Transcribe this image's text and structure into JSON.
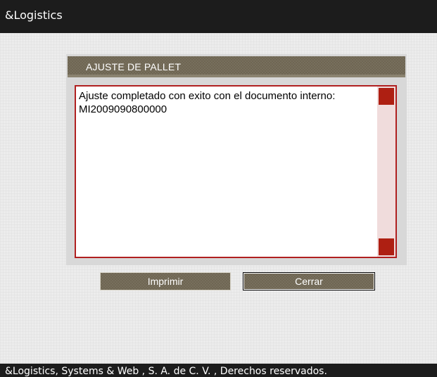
{
  "app": {
    "title": "&Logistics"
  },
  "dialog": {
    "title": "AJUSTE DE PALLET",
    "message": "Ajuste completado con exito con el documento interno: MI2009090800000"
  },
  "buttons": {
    "print_label": "Imprimir",
    "close_label": "Cerrar"
  },
  "footer": {
    "text": "&Logistics, Systems & Web , S. A. de C. V. , Derechos reservados."
  },
  "colors": {
    "titlebar": "#1c1c1c",
    "header_bg": "#6f6653",
    "border_accent": "#b02020",
    "scroll_button": "#ae1f12",
    "scroll_track": "#f0dcdc",
    "workspace": "#ececec"
  }
}
